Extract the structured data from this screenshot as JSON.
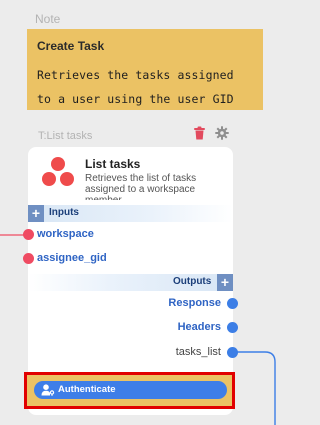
{
  "note": {
    "title": "Note",
    "header": "Create Task",
    "line1": "Retrieves the tasks assigned",
    "line2": "to a user using the user GID"
  },
  "node": {
    "label": "T:List tasks",
    "title": "List tasks",
    "description": "Retrieves the list of tasks assigned to a workspace member"
  },
  "inputs": {
    "label": "Inputs",
    "ports": [
      "workspace",
      "assignee_gid"
    ]
  },
  "outputs": {
    "label": "Outputs",
    "ports": [
      "Response",
      "Headers",
      "tasks_list"
    ]
  },
  "auth": {
    "label": "Authenticate"
  },
  "colors": {
    "note_bg": "#ebc264",
    "input_port": "#ef4b62",
    "output_port": "#3c7ee6",
    "highlight": "#e10000",
    "button": "#3e7ee8"
  }
}
